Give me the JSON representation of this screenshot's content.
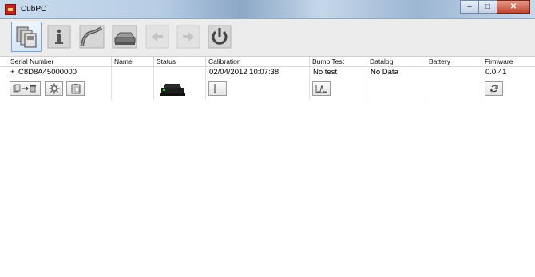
{
  "window": {
    "title": "CubPC"
  },
  "toolbar": {
    "buttons": [
      {
        "name": "devices-icon",
        "active": true
      },
      {
        "name": "info-icon",
        "active": false
      },
      {
        "name": "calibration-icon",
        "active": false
      },
      {
        "name": "docking-station-icon",
        "active": false
      },
      {
        "name": "back-arrow-icon",
        "active": false,
        "disabled": true
      },
      {
        "name": "forward-arrow-icon",
        "active": false,
        "disabled": true
      },
      {
        "name": "power-icon",
        "active": false
      }
    ]
  },
  "table": {
    "columns": [
      "Serial Number",
      "Name",
      "Status",
      "Calibration",
      "Bump Test",
      "Datalog",
      "Battery",
      "Firmware"
    ],
    "rows": [
      {
        "expand": "+",
        "serial": "C8D8A45000000",
        "name": "",
        "calibration": "02/04/2012 10:07:38",
        "bump_test": "No test",
        "datalog": "No Data",
        "battery": "",
        "firmware": "0.0.41"
      }
    ]
  }
}
